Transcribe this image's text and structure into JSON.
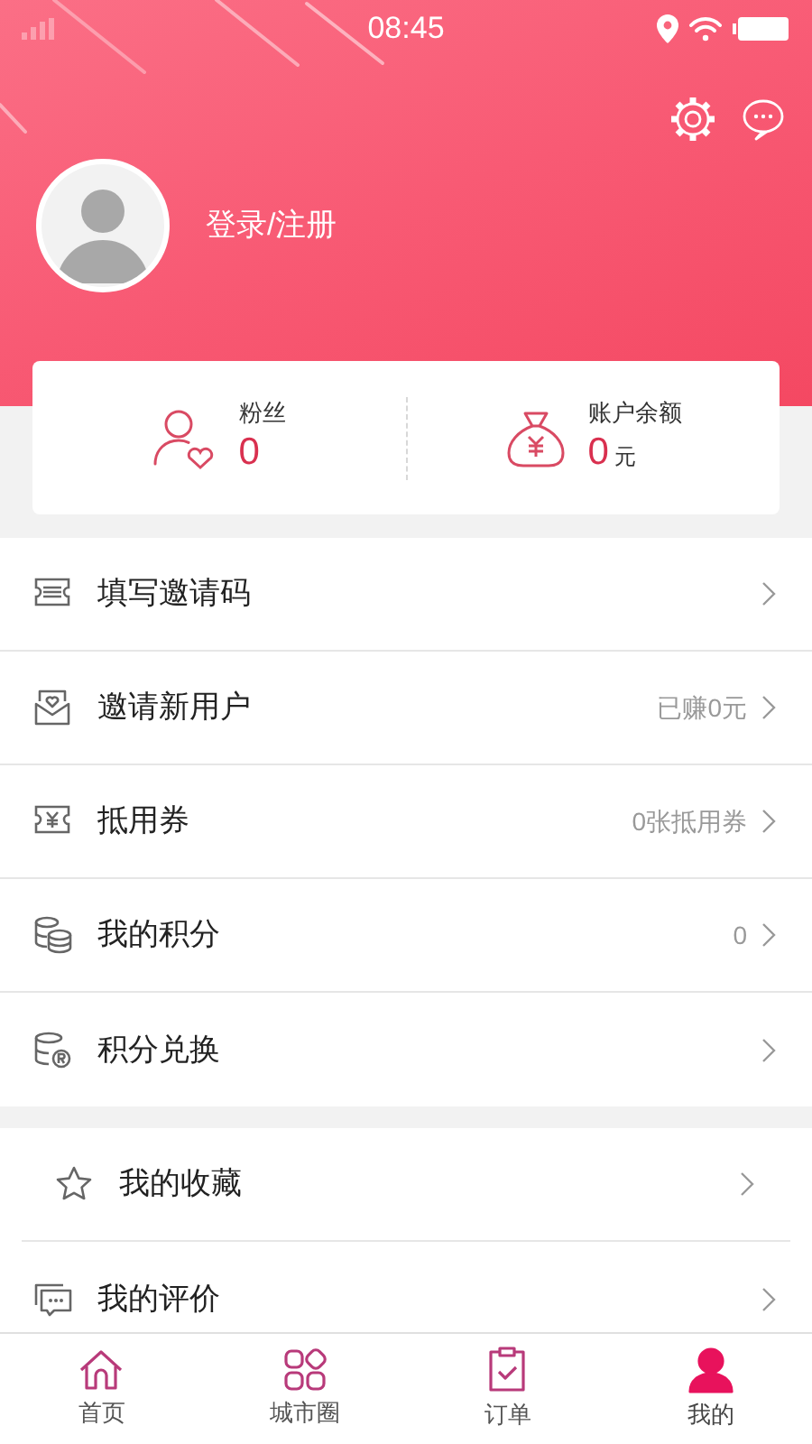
{
  "status_bar": {
    "time": "08:45"
  },
  "profile": {
    "login_label": "登录/注册"
  },
  "stats": [
    {
      "kind": "fans",
      "label": "粉丝",
      "value": "0"
    },
    {
      "kind": "balance",
      "label": "账户余额",
      "value": "0",
      "unit": "元"
    }
  ],
  "menu_sections": [
    {
      "items": [
        {
          "kind": "ticket",
          "label": "填写邀请码"
        },
        {
          "kind": "invite",
          "label": "邀请新用户",
          "detail": "已赚0元"
        },
        {
          "kind": "coupon",
          "label": "抵用券",
          "detail": "0张抵用券"
        },
        {
          "kind": "points",
          "label": "我的积分",
          "detail": "0"
        },
        {
          "kind": "exchange",
          "label": "积分兑换"
        }
      ]
    },
    {
      "items": [
        {
          "kind": "favorite",
          "label": "我的收藏"
        },
        {
          "kind": "review",
          "label": "我的评价"
        }
      ]
    }
  ],
  "tabs": [
    {
      "kind": "home",
      "label": "首页",
      "selected": false
    },
    {
      "kind": "circle",
      "label": "城市圈",
      "selected": false
    },
    {
      "kind": "order",
      "label": "订单",
      "selected": false
    },
    {
      "kind": "me",
      "label": "我的",
      "selected": true
    }
  ]
}
